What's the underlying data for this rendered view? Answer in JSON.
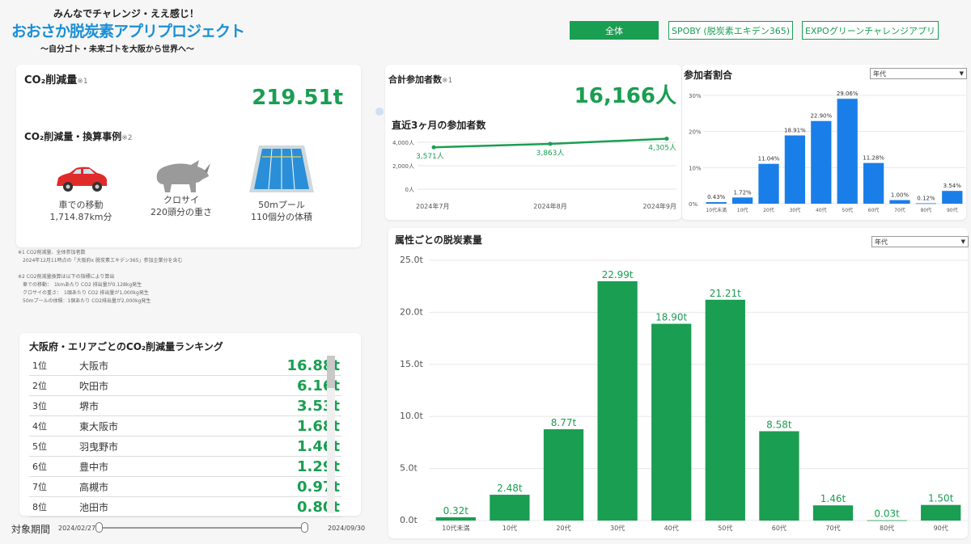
{
  "header": {
    "tagline": "みんなでチャレンジ・ええ感じ！",
    "title": "おおさか脱炭素アプリプロジェクト",
    "subtitle": "〜自分ゴト・未来ゴトを大阪から世界へ〜",
    "tabs": [
      {
        "label": "全体",
        "active": true
      },
      {
        "label": "SPOBY (脱炭素エキデン365)",
        "active": false
      },
      {
        "label": "EXPOグリーンチャレンジアプリ",
        "active": false
      }
    ]
  },
  "co2": {
    "title": "CO₂削減量",
    "note_mark": "※1",
    "value": "219.51t",
    "equiv_title": "CO₂削減量・換算事例",
    "equiv_note_mark": "※2",
    "examples": [
      {
        "icon": "car-icon",
        "line1": "車での移動",
        "line2": "1,714.87km分"
      },
      {
        "icon": "rhino-icon",
        "line1": "クロサイ",
        "line2": "220頭分の重さ"
      },
      {
        "icon": "pool-icon",
        "line1": "50mプール",
        "line2": "110個分の体積"
      }
    ]
  },
  "notes": [
    "※1 CO2削減量、全体参加者数",
    "2024年12月11時点の「大阪府x 脱炭素エキデン365」参加企業分を含む",
    "",
    "※2 CO2削減量換算は以下の指標により算出",
    "車での移動：　1kmあたり CO2 排出量が0.128kg発生",
    "クロサイの重さ：　1頭あたり CO2 排出量が1,000kg発生",
    "50mプールの体積：1個あたり CO2排出量が2,000kg発生"
  ],
  "ranking": {
    "title": "大阪府・エリアごとのCO₂削減量ランキング",
    "rows": [
      {
        "pos": "1位",
        "name": "大阪市",
        "value": "16.88t"
      },
      {
        "pos": "2位",
        "name": "吹田市",
        "value": "6.16t"
      },
      {
        "pos": "3位",
        "name": "堺市",
        "value": "3.53t"
      },
      {
        "pos": "4位",
        "name": "東大阪市",
        "value": "1.68t"
      },
      {
        "pos": "5位",
        "name": "羽曳野市",
        "value": "1.46t"
      },
      {
        "pos": "6位",
        "name": "豊中市",
        "value": "1.29t"
      },
      {
        "pos": "7位",
        "name": "高槻市",
        "value": "0.97t"
      },
      {
        "pos": "8位",
        "name": "池田市",
        "value": "0.80t"
      }
    ]
  },
  "period": {
    "label": "対象期間",
    "start": "2024/02/27",
    "end": "2024/09/30",
    "range_fraction": [
      0.0,
      1.0
    ]
  },
  "participants": {
    "title": "合計参加者数",
    "note_mark": "※1",
    "value": "16,166人",
    "recent_title": "直近3ヶ月の参加者数"
  },
  "ratio": {
    "title": "参加者割合",
    "select_value": "年代"
  },
  "attr": {
    "title": "属性ごとの脱炭素量",
    "select_value": "年代"
  },
  "colors": {
    "green": "#1a9e52",
    "blue": "#1a7ee8"
  },
  "chart_data": [
    {
      "id": "recent-participants",
      "type": "line",
      "x": [
        "2024年7月",
        "2024年8月",
        "2024年9月"
      ],
      "values": [
        3571,
        3863,
        4305
      ],
      "value_labels": [
        "3,571人",
        "3,863人",
        "4,305人"
      ],
      "yticks": [
        "0人",
        "2,000人",
        "4,000人"
      ],
      "ylim": [
        0,
        4000
      ],
      "grid": true
    },
    {
      "id": "participant-ratio",
      "type": "bar",
      "categories": [
        "10代未満",
        "10代",
        "20代",
        "30代",
        "40代",
        "50代",
        "60代",
        "70代",
        "80代",
        "90代"
      ],
      "values": [
        0.43,
        1.72,
        11.04,
        18.91,
        22.9,
        29.06,
        11.28,
        1.0,
        0.12,
        3.54
      ],
      "value_labels": [
        "0.43%",
        "1.72%",
        "11.04%",
        "18.91%",
        "22.90%",
        "29.06%",
        "11.28%",
        "1.00%",
        "0.12%",
        "3.54%"
      ],
      "yticks": [
        "0%",
        "10%",
        "20%",
        "30%"
      ],
      "ylim": [
        0,
        30
      ],
      "grid": true
    },
    {
      "id": "attr-decarb",
      "type": "bar",
      "categories": [
        "10代未満",
        "10代",
        "20代",
        "30代",
        "40代",
        "50代",
        "60代",
        "70代",
        "80代",
        "90代"
      ],
      "values": [
        0.32,
        2.48,
        8.77,
        22.99,
        18.9,
        21.21,
        8.58,
        1.46,
        0.03,
        1.5
      ],
      "value_labels": [
        "0.32t",
        "2.48t",
        "8.77t",
        "22.99t",
        "18.90t",
        "21.21t",
        "8.58t",
        "1.46t",
        "0.03t",
        "1.50t"
      ],
      "yticks": [
        "0.0t",
        "5.0t",
        "10.0t",
        "15.0t",
        "20.0t",
        "25.0t"
      ],
      "ylim": [
        0,
        25
      ],
      "grid": true
    }
  ]
}
